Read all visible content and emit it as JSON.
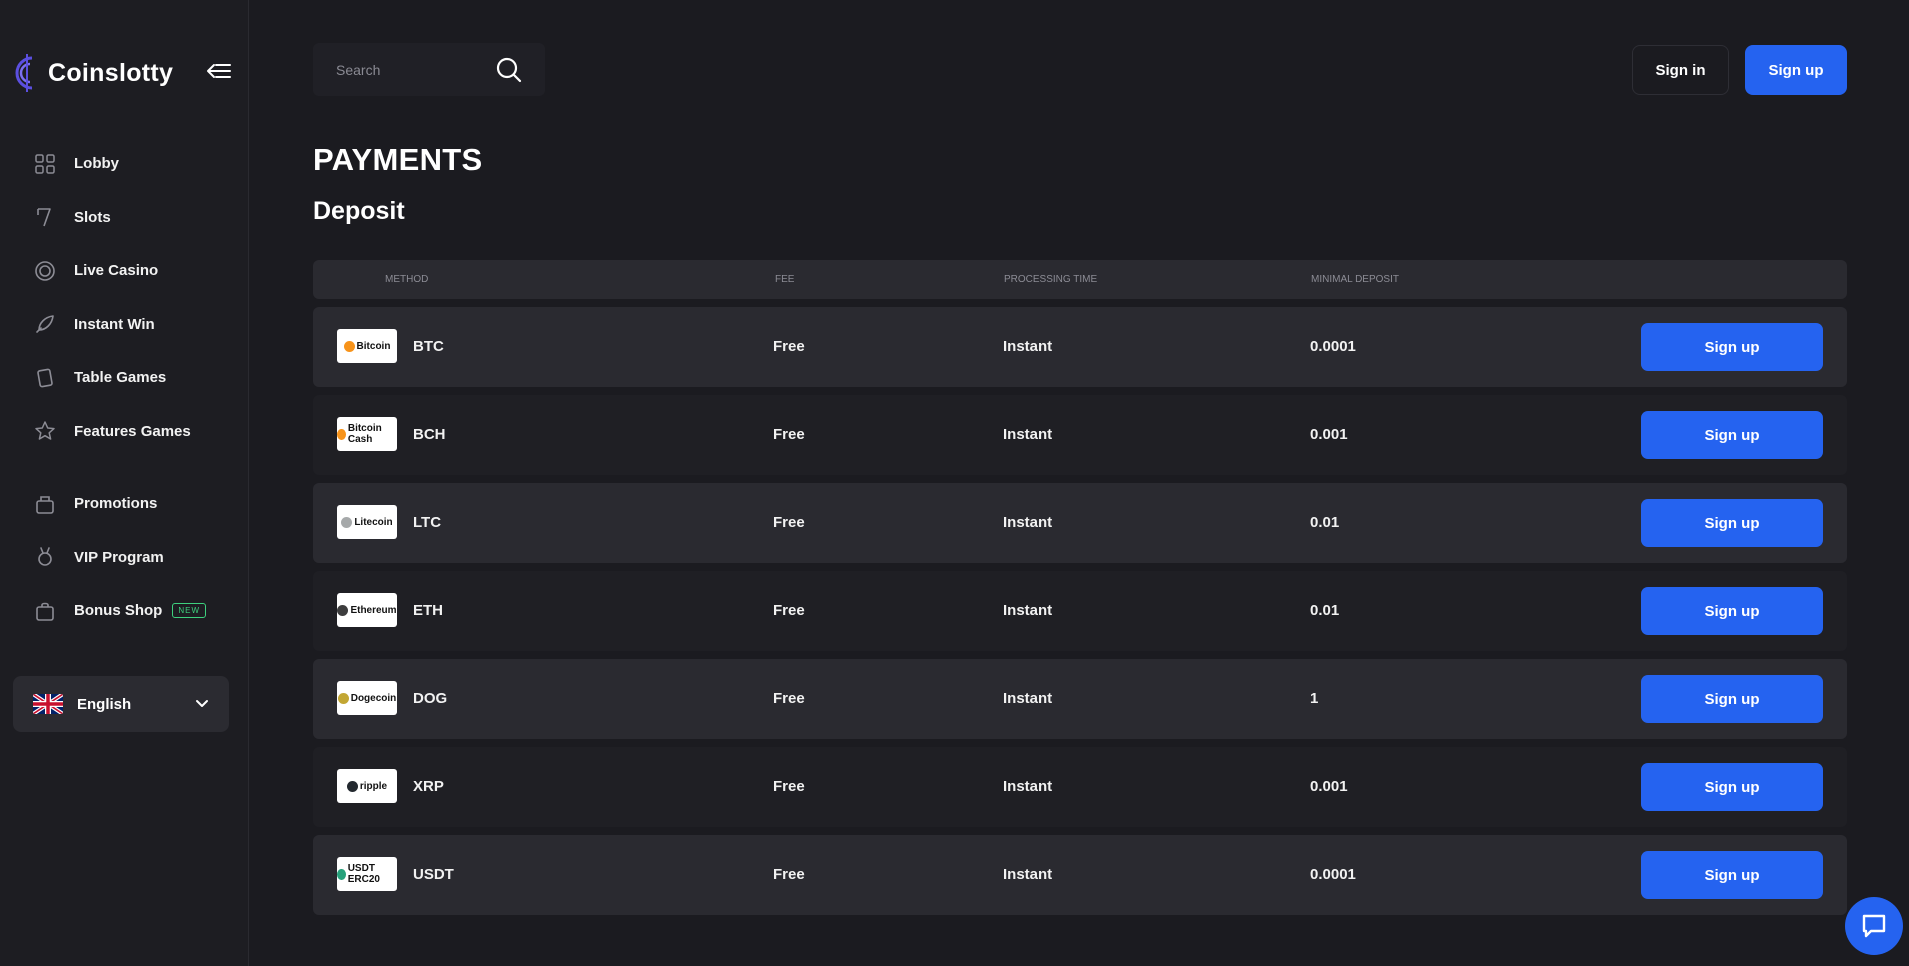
{
  "brand": {
    "name": "Coinslotty",
    "accent": "#2563f0",
    "logo_color": "#5b4fe0"
  },
  "sidebar": {
    "items": [
      {
        "label": "Lobby",
        "icon": "grid-icon"
      },
      {
        "label": "Slots",
        "icon": "slot-machine-icon"
      },
      {
        "label": "Live Casino",
        "icon": "roulette-icon"
      },
      {
        "label": "Instant Win",
        "icon": "rocket-icon"
      },
      {
        "label": "Table Games",
        "icon": "cards-icon"
      },
      {
        "label": "Features Games",
        "icon": "star-icon"
      }
    ],
    "items2": [
      {
        "label": "Promotions",
        "icon": "gift-icon"
      },
      {
        "label": "VIP Program",
        "icon": "medal-icon"
      },
      {
        "label": "Bonus Shop",
        "icon": "shop-bag-icon",
        "badge": "NEW"
      }
    ],
    "language": "English"
  },
  "header": {
    "search_placeholder": "Search",
    "sign_in": "Sign in",
    "sign_up": "Sign up"
  },
  "page": {
    "title": "PAYMENTS",
    "section": "Deposit"
  },
  "table": {
    "columns": [
      "METHOD",
      "FEE",
      "PROCESSING TIME",
      "MINIMAL DEPOSIT"
    ],
    "rows": [
      {
        "logo": "Bitcoin",
        "logo_color": "#f7931a",
        "code": "BTC",
        "fee": "Free",
        "time": "Instant",
        "min": "0.0001",
        "action": "Sign up"
      },
      {
        "logo": "Bitcoin Cash",
        "logo_color": "#f7931a",
        "code": "BCH",
        "fee": "Free",
        "time": "Instant",
        "min": "0.001",
        "action": "Sign up"
      },
      {
        "logo": "Litecoin",
        "logo_color": "#a6a9aa",
        "code": "LTC",
        "fee": "Free",
        "time": "Instant",
        "min": "0.01",
        "action": "Sign up"
      },
      {
        "logo": "Ethereum",
        "logo_color": "#3c3c3d",
        "code": "ETH",
        "fee": "Free",
        "time": "Instant",
        "min": "0.01",
        "action": "Sign up"
      },
      {
        "logo": "Dogecoin",
        "logo_color": "#c2a633",
        "code": "DOG",
        "fee": "Free",
        "time": "Instant",
        "min": "1",
        "action": "Sign up"
      },
      {
        "logo": "ripple",
        "logo_color": "#23292f",
        "code": "XRP",
        "fee": "Free",
        "time": "Instant",
        "min": "0.001",
        "action": "Sign up"
      },
      {
        "logo": "USDT ERC20",
        "logo_color": "#26a17b",
        "code": "USDT",
        "fee": "Free",
        "time": "Instant",
        "min": "0.0001",
        "action": "Sign up"
      }
    ]
  }
}
